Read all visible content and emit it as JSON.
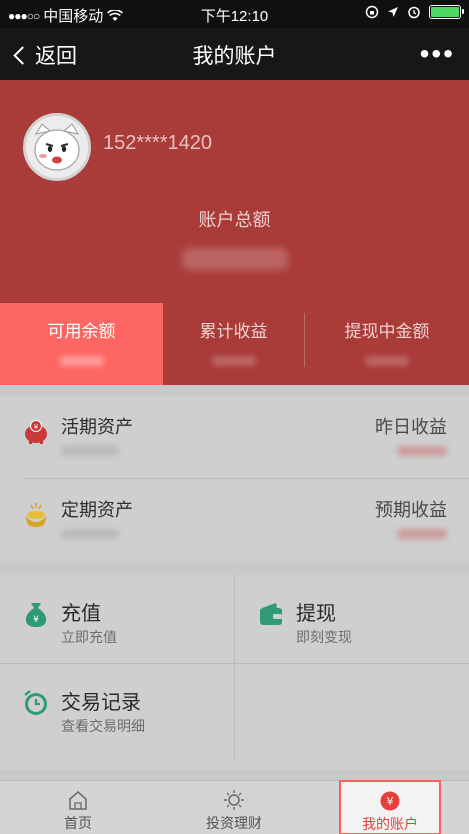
{
  "status_bar": {
    "signal": "●●●○○",
    "carrier": "中国移动",
    "time": "下午12:10",
    "battery_level": 1.0
  },
  "nav": {
    "back_label": "返回",
    "title": "我的账户",
    "more_label": "•••"
  },
  "account": {
    "phone": "152****1420",
    "total_label": "账户总额"
  },
  "balance_tabs": [
    {
      "label": "可用余额",
      "active": true
    },
    {
      "label": "累计收益",
      "active": false
    },
    {
      "label": "提现中金额",
      "active": false
    }
  ],
  "assets": [
    {
      "title": "活期资产",
      "right_label": "昨日收益",
      "icon": "piggy-bank-icon"
    },
    {
      "title": "定期资产",
      "right_label": "预期收益",
      "icon": "gold-ingot-icon"
    }
  ],
  "actions": [
    {
      "title": "充值",
      "subtitle": "立即充值",
      "icon": "money-bag-icon"
    },
    {
      "title": "提现",
      "subtitle": "即刻变现",
      "icon": "wallet-icon"
    },
    {
      "title": "交易记录",
      "subtitle": "查看交易明细",
      "icon": "clock-icon"
    }
  ],
  "tab_bar": [
    {
      "label": "首页",
      "icon": "home-icon"
    },
    {
      "label": "投资理财",
      "icon": "sun-icon"
    },
    {
      "label": "我的账户",
      "icon": "yen-icon",
      "active": true
    }
  ],
  "colors": {
    "header_red": "#a93b39",
    "active_tab": "#fe6663",
    "accent_red": "#e53f3c",
    "icon_green": "#2f9a74"
  }
}
